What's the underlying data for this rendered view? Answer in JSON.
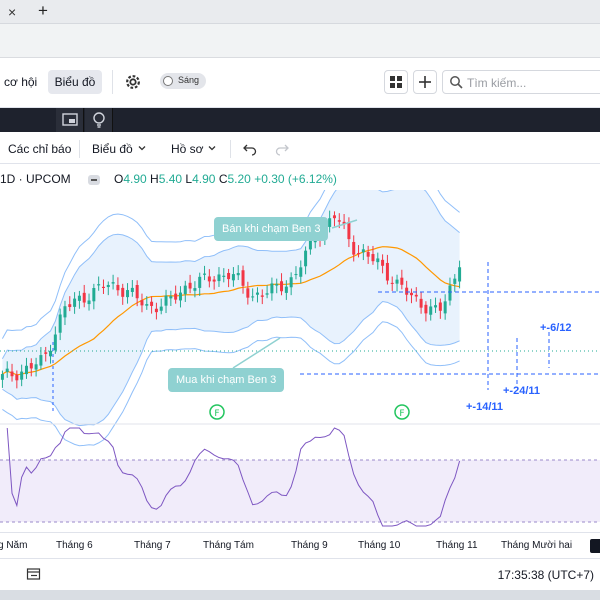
{
  "colors": {
    "up": "#22ab94",
    "down": "#f23645",
    "band": "#90bff9",
    "band_fill": "#e8f2fd",
    "ma": "#ff9800",
    "rsi": "#7e57c2",
    "rsi_fill": "#f1ecfa",
    "level_line": "#2962ff",
    "anno_bg": "#8fd1d1"
  },
  "browser": {
    "close_glyph": "×",
    "new_tab_glyph": "+"
  },
  "appbar": {
    "nav_partial": "n cơ hội",
    "nav_active": "Biểu đồ",
    "theme_label": "Sáng",
    "search_placeholder": "Tìm kiếm..."
  },
  "toolbar": {
    "indicators": "Các chỉ báo",
    "chart": "Biểu đồ",
    "profile": "Hồ sơ"
  },
  "legend": {
    "symbol": "1D · UPCOM",
    "o_label": "O",
    "o": "4.90",
    "h_label": "H",
    "h": "5.40",
    "l_label": "L",
    "l": "4.90",
    "c_label": "C",
    "c": "5.20",
    "chg": "+0.30 (+6.12%)"
  },
  "annotations": {
    "sell": "Bán khi chạm Ben 3",
    "buy": "Mua khi chạm Ben 3",
    "f_marker": "F"
  },
  "levels": {
    "l1": "+-6/12",
    "l2": "+-24/11",
    "l3": "+-14/11"
  },
  "time_axis": [
    "g Năm",
    "Tháng 6",
    "Tháng 7",
    "Tháng Tám",
    "Tháng 9",
    "Tháng 10",
    "Tháng 11",
    "Tháng Mười hai"
  ],
  "status": {
    "clock": "17:35:38 (UTC+7)"
  },
  "chart_data": {
    "type": "candlestick",
    "title": "",
    "xlabel": "",
    "ylabel": "",
    "x": [
      "Tháng 6",
      "Tháng 7",
      "Tháng Tám",
      "Tháng 9",
      "Tháng 10",
      "Tháng 11"
    ],
    "close_start": 3.3,
    "close_peak": 6.1,
    "close_last": 5.2,
    "last_ohlc": {
      "open": 4.9,
      "high": 5.4,
      "low": 4.9,
      "close": 5.2
    },
    "series": [
      {
        "name": "",
        "kind": "price_path",
        "values": [
          3.3,
          3.4,
          3.6,
          4.5,
          4.7,
          4.9,
          4.8,
          4.5,
          4.6,
          4.9,
          5.0,
          5.1,
          4.7,
          4.8,
          5.0,
          5.7,
          6.1,
          5.5,
          5.3,
          4.9,
          4.6,
          4.4,
          5.2
        ]
      }
    ],
    "grid": false,
    "legend": "top-left"
  }
}
